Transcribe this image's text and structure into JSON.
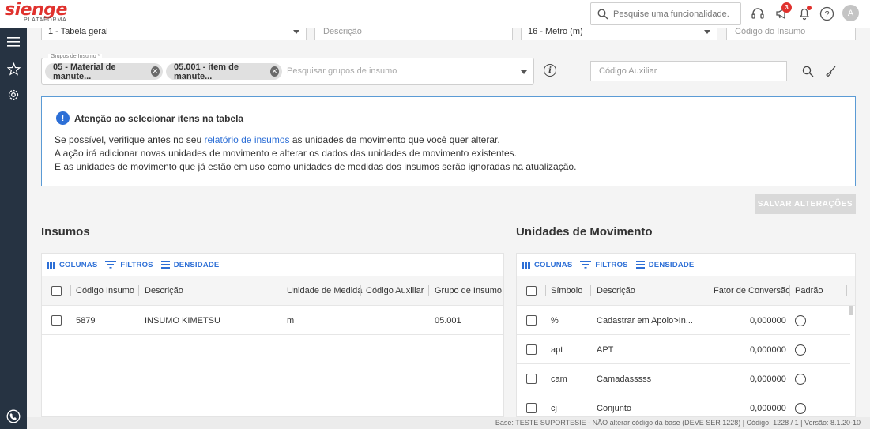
{
  "header": {
    "logo": "sienge",
    "logo_sub": "PLATAFORMA",
    "search_placeholder": "Pesquise uma funcionalidade.",
    "notification_count": "3",
    "avatar_initial": "A"
  },
  "form": {
    "tabela": "1 - Tabela geral",
    "descricao_placeholder": "Descrição",
    "unidade": "16 - Metro (m)",
    "codigo_insumo_placeholder": "Código do Insumo",
    "grupos_legend": "Grupos de Insumo *",
    "chips": [
      "05 - Material de manute...",
      "05.001 - item de manute..."
    ],
    "grupos_placeholder": "Pesquisar grupos de insumo",
    "codigo_auxiliar_placeholder": "Código Auxiliar"
  },
  "alert": {
    "title": "Atenção ao selecionar itens na tabela",
    "line1_pre": "Se possível, verifique antes no seu ",
    "line1_link": "relatório de insumos",
    "line1_post": " as unidades de movimento que você quer alterar.",
    "line2": "A ação irá adicionar novas unidades de movimento e alterar os dados das unidades de movimento existentes.",
    "line3": "E as unidades de movimento que já estão em uso como unidades de medidas dos insumos serão ignoradas na atualização."
  },
  "save_label": "SALVAR ALTERAÇÕES",
  "toolbar": {
    "columns": "COLUNAS",
    "filters": "FILTROS",
    "density": "DENSIDADE"
  },
  "insumos": {
    "title": "Insumos",
    "headers": [
      "Código Insumo",
      "Descrição",
      "Unidade de Medida",
      "Código Auxiliar",
      "Grupo de Insumo"
    ],
    "rows": [
      {
        "codigo": "5879",
        "descricao": "INSUMO KIMETSU",
        "unidade": "m",
        "auxiliar": "",
        "grupo": "05.001"
      }
    ]
  },
  "unidades": {
    "title": "Unidades de Movimento",
    "headers": [
      "Símbolo",
      "Descrição",
      "Fator de Conversão",
      "Padrão"
    ],
    "rows": [
      {
        "simbolo": "%",
        "descricao": "Cadastrar em Apoio>In...",
        "fator": "0,000000"
      },
      {
        "simbolo": "apt",
        "descricao": "APT",
        "fator": "0,000000"
      },
      {
        "simbolo": "cam",
        "descricao": "Camadasssss",
        "fator": "0,000000"
      },
      {
        "simbolo": "cj",
        "descricao": "Conjunto",
        "fator": "0,000000"
      }
    ]
  },
  "status_bar": "Base: TESTE SUPORTESIE - NÃO alterar código da base (DEVE SER 1228)  |  Código: 1228 / 1  |  Versão: 8.1.20-10",
  "colors": {
    "brand": "#e0322e",
    "accent": "#2d6fd6",
    "rail": "#263342"
  }
}
